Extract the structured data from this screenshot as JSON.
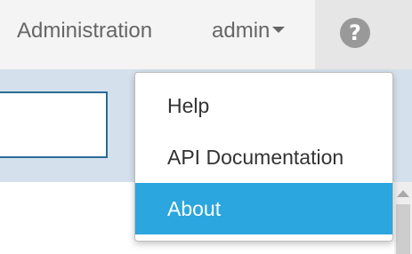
{
  "topbar": {
    "admin_link": "Administration",
    "user_menu": "admin",
    "help_icon": "question-circle-icon"
  },
  "dropdown": {
    "items": [
      {
        "label": "Help",
        "active": false
      },
      {
        "label": "API Documentation",
        "active": false
      },
      {
        "label": "About",
        "active": true
      }
    ],
    "highlight_color": "#2ba6de"
  },
  "colors": {
    "topbar_bg": "#f4f4f4",
    "band_bg": "#d4e1ec",
    "input_border": "#2a6b96"
  }
}
